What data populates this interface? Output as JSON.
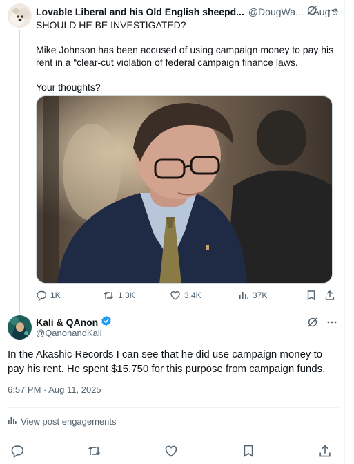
{
  "parent_post": {
    "display_name": "Lovable Liberal and his Old English sheepd...",
    "handle": "@DougWa...",
    "date": "· Aug 9",
    "paragraphs": [
      "SHOULD HE BE INVESTIGATED?",
      "",
      "Mike Johnson has been accused of using campaign money to pay his rent in a “clear-cut violation of federal campaign finance laws.",
      "",
      "Your thoughts?"
    ],
    "stats": {
      "replies": "1K",
      "reposts": "1.3K",
      "likes": "3.4K",
      "views": "37K"
    }
  },
  "reply_post": {
    "display_name": "Kali & QAnon",
    "handle": "@QanonandKali",
    "text": "In the Akashic Records I can see that he did use campaign money to pay his rent.  He spent $15,750 for this purpose from campaign funds.",
    "timestamp": "6:57 PM · Aug 11, 2025",
    "engagements_label": "View post engagements"
  },
  "colors": {
    "text_primary": "#0f1419",
    "text_secondary": "#536471",
    "verified": "#1d9bf0",
    "divider": "#eff3f4"
  },
  "icons": [
    "grok-icon",
    "more-icon",
    "reply-icon",
    "repost-icon",
    "like-icon",
    "views-icon",
    "bookmark-icon",
    "share-icon",
    "verified-badge-icon",
    "engagements-icon"
  ]
}
